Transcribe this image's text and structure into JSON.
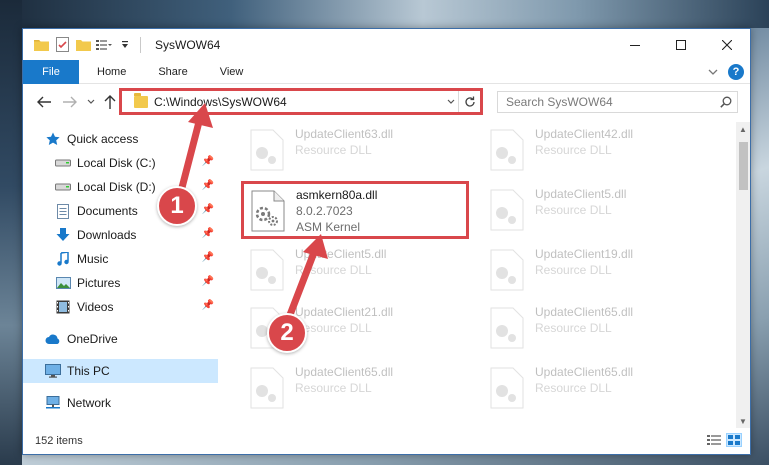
{
  "window": {
    "title": "SysWOW64"
  },
  "ribbon": {
    "tabs": [
      "File",
      "Home",
      "Share",
      "View"
    ],
    "help": "?"
  },
  "address": {
    "path": "C:\\Windows\\SysWOW64"
  },
  "search": {
    "placeholder": "Search SysWOW64"
  },
  "sidebar": {
    "items": [
      {
        "label": "Quick access",
        "icon": "star-icon",
        "pinned": false
      },
      {
        "label": "Local Disk (C:)",
        "icon": "drive-icon",
        "pinned": true
      },
      {
        "label": "Local Disk (D:)",
        "icon": "drive-icon",
        "pinned": true
      },
      {
        "label": "Documents",
        "icon": "documents-icon",
        "pinned": true
      },
      {
        "label": "Downloads",
        "icon": "download-arrow-icon",
        "pinned": true
      },
      {
        "label": "Music",
        "icon": "music-note-icon",
        "pinned": true
      },
      {
        "label": "Pictures",
        "icon": "pictures-icon",
        "pinned": true
      },
      {
        "label": "Videos",
        "icon": "film-icon",
        "pinned": true
      },
      {
        "label": "OneDrive",
        "icon": "cloud-icon",
        "pinned": false
      },
      {
        "label": "This PC",
        "icon": "monitor-icon",
        "pinned": false,
        "selected": true
      },
      {
        "label": "Network",
        "icon": "network-icon",
        "pinned": false
      }
    ]
  },
  "files": {
    "highlighted": {
      "name": "asmkern80a.dll",
      "version": "8.0.2.7023",
      "description": "ASM Kernel"
    },
    "left_column": [
      {
        "name": "UpdateClient63.dll",
        "type": "Resource DLL"
      },
      {
        "name": "UpdateClient5.dll",
        "type": "Resource DLL"
      },
      {
        "name": "UpdateClient21.dll",
        "type": "Resource DLL"
      },
      {
        "name": "UpdateClient65.dll",
        "type": "Resource DLL"
      }
    ],
    "right_column": [
      {
        "name": "UpdateClient42.dll",
        "type": "Resource DLL"
      },
      {
        "name": "UpdateClient5.dll",
        "type": "Resource DLL"
      },
      {
        "name": "UpdateClient19.dll",
        "type": "Resource DLL"
      },
      {
        "name": "UpdateClient65.dll",
        "type": "Resource DLL"
      },
      {
        "name": "UpdateClient65.dll",
        "type": "Resource DLL"
      }
    ]
  },
  "status": {
    "item_count": "152 items"
  },
  "annotations": {
    "step1": "1",
    "step2": "2"
  },
  "colors": {
    "accent": "#1979ca",
    "highlight_red": "#d9474b",
    "selected_bg": "#cce8ff"
  }
}
